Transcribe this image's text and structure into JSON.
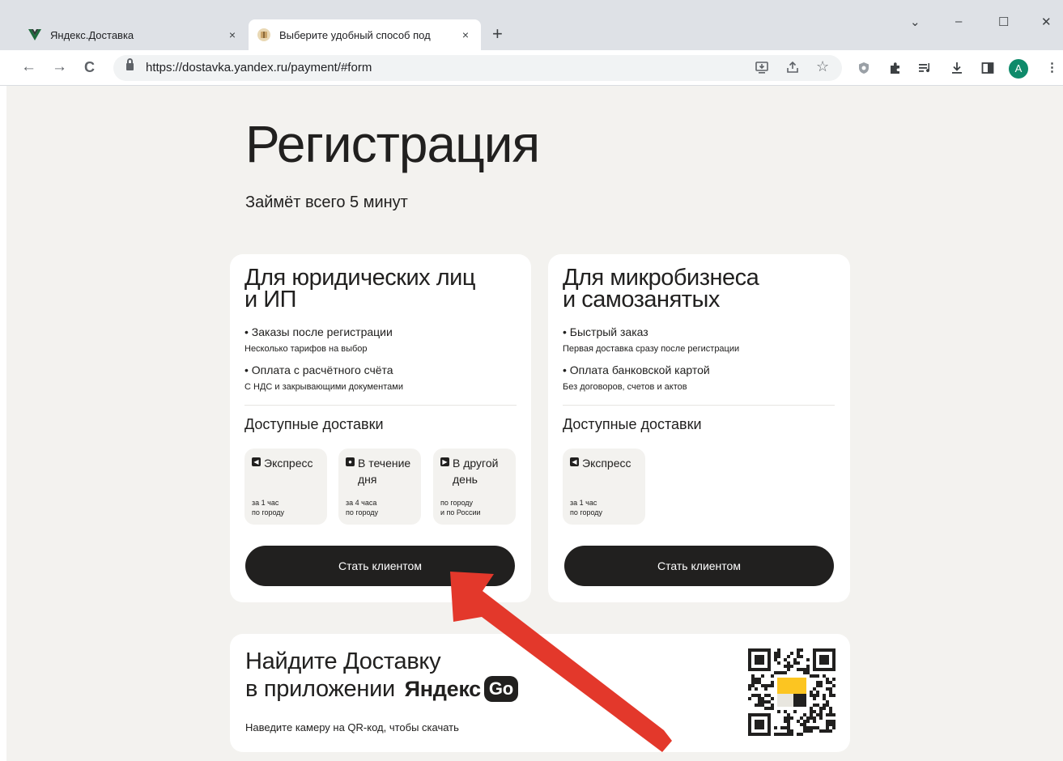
{
  "browser": {
    "tabs": [
      {
        "title": "Яндекс.Доставка",
        "close": "×"
      },
      {
        "title": "Выберите удобный способ под",
        "close": "×"
      }
    ],
    "new_tab": "+",
    "window_controls": {
      "dropdown": "⌄",
      "minimize": "–",
      "maximize": "☐",
      "close": "✕"
    },
    "nav": {
      "back": "←",
      "forward": "→",
      "reload": "C"
    },
    "url": "https://dostavka.yandex.ru/payment/#form",
    "avatar_letter": "A",
    "icons": [
      "install-icon",
      "share-icon",
      "star-icon",
      "shield-extension-icon",
      "puzzle-extension-icon",
      "media-control-icon",
      "download-icon",
      "side-panel-icon",
      "kebab-menu-icon"
    ]
  },
  "page": {
    "title": "Регистрация",
    "subtitle": "Займёт всего 5 минут",
    "cards": [
      {
        "title": "Для юридических лиц\nи ИП",
        "features": [
          {
            "title": "• Заказы после регистрации",
            "subtitle": "Несколько тарифов на выбор"
          },
          {
            "title": "• Оплата с расчётного счёта",
            "subtitle": "С НДС и закрывающими документами"
          }
        ],
        "deliveries_heading": "Доступные доставки",
        "deliveries": [
          {
            "name": "Экспресс",
            "note": "за 1 час\nпо городу"
          },
          {
            "name": "В течение дня",
            "note": "за 4 часа\nпо городу"
          },
          {
            "name": "В другой день",
            "note": "по городу\nи по России"
          }
        ],
        "cta": "Стать клиентом"
      },
      {
        "title": "Для микробизнеса\nи самозанятых",
        "features": [
          {
            "title": "• Быстрый заказ",
            "subtitle": "Первая доставка сразу после регистрации"
          },
          {
            "title": "• Оплата банковской картой",
            "subtitle": "Без договоров, счетов и актов"
          }
        ],
        "deliveries_heading": "Доступные доставки",
        "deliveries": [
          {
            "name": "Экспресс",
            "note": "за 1 час\nпо городу"
          }
        ],
        "cta": "Стать клиентом"
      }
    ],
    "app_promo": {
      "title_line1": "Найдите Доставку",
      "title_line2": "в приложении",
      "brand": "Яндекс",
      "brand_badge": "Go",
      "hint": "Наведите камеру на QR-код, чтобы скачать"
    }
  },
  "annotation": {
    "type": "arrow",
    "color": "#e3382b"
  },
  "colors": {
    "text": "#21201f",
    "background": "#f3f2ef",
    "button": "#21201f",
    "accent_yellow": "#fcc521"
  }
}
